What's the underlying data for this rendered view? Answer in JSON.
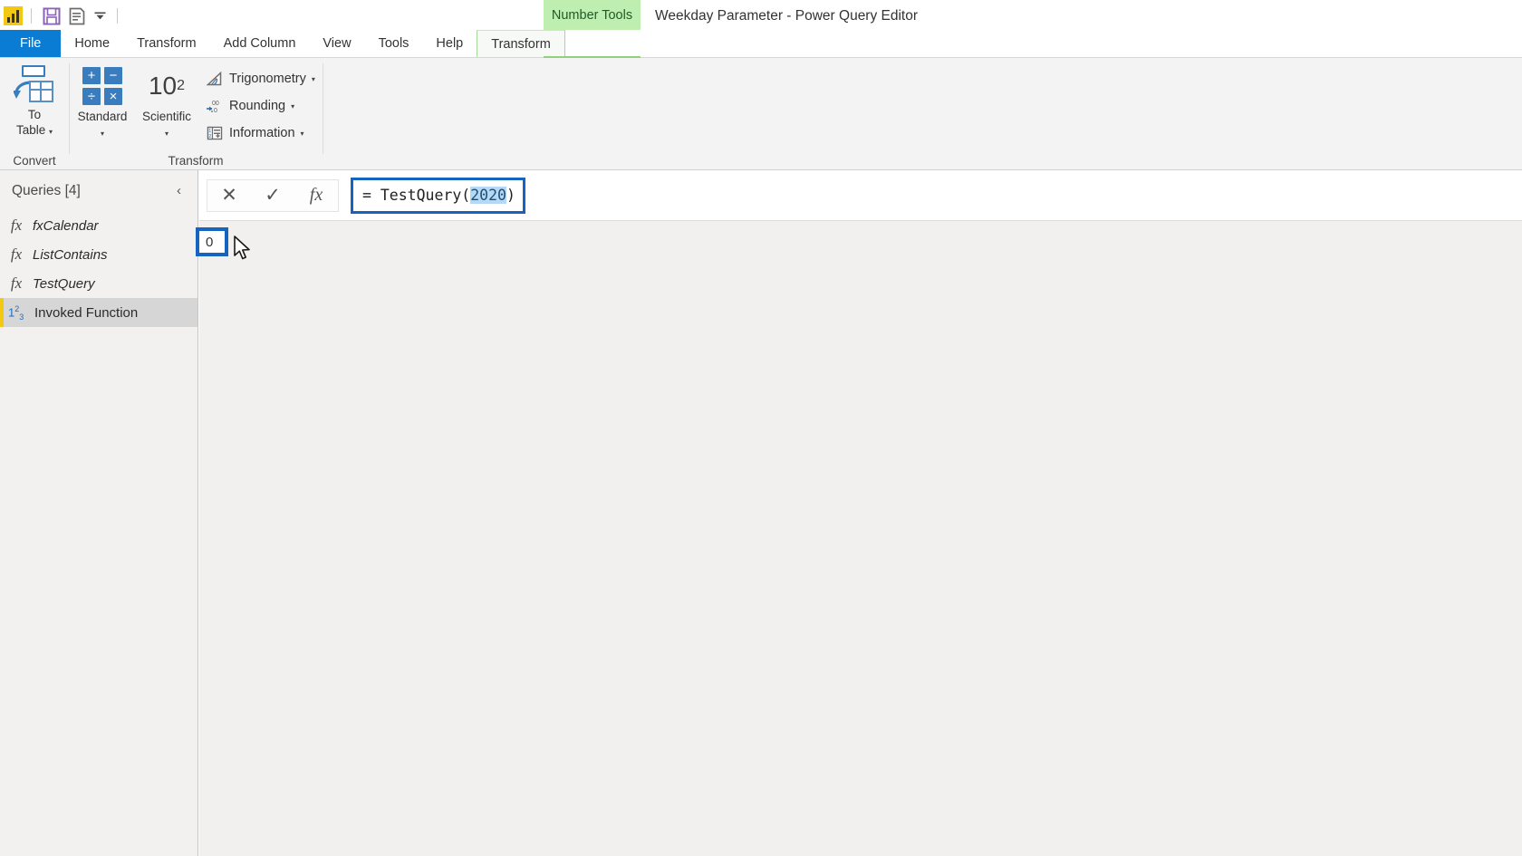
{
  "window": {
    "title": "Weekday Parameter - Power Query Editor",
    "contextual_tab_group": "Number Tools"
  },
  "quick_access": {
    "items": [
      {
        "name": "powerbi-logo",
        "label": "Power BI"
      },
      {
        "name": "save-icon",
        "label": "Save"
      },
      {
        "name": "document-icon",
        "label": "Recent Sources"
      },
      {
        "name": "chevron-down-icon",
        "label": "Customize Quick Access Toolbar"
      }
    ]
  },
  "ribbon": {
    "tabs": [
      {
        "label": "File",
        "state": "file"
      },
      {
        "label": "Home",
        "state": "normal"
      },
      {
        "label": "Transform",
        "state": "normal"
      },
      {
        "label": "Add Column",
        "state": "normal"
      },
      {
        "label": "View",
        "state": "normal"
      },
      {
        "label": "Tools",
        "state": "normal"
      },
      {
        "label": "Help",
        "state": "normal"
      },
      {
        "label": "Transform",
        "state": "contextual-active"
      }
    ],
    "groups": [
      {
        "label": "Convert",
        "buttons": [
          {
            "label_line1": "To",
            "label_line2": "Table",
            "icon": "to-table-icon",
            "has_caret": true
          }
        ]
      },
      {
        "label": "Transform",
        "buttons": [
          {
            "label_line1": "Standard",
            "label_line2": "",
            "icon": "standard-calculator-icon",
            "has_caret": true
          },
          {
            "label_line1": "Scientific",
            "label_line2": "",
            "icon": "scientific-icon",
            "has_caret": true
          }
        ],
        "small_buttons": [
          {
            "label": "Trigonometry",
            "icon": "trigonometry-icon",
            "has_caret": true
          },
          {
            "label": "Rounding",
            "icon": "rounding-icon",
            "has_caret": true
          },
          {
            "label": "Information",
            "icon": "information-icon",
            "has_caret": true
          }
        ]
      }
    ],
    "standard_icon_glyphs": [
      "+",
      "−",
      "÷",
      "×"
    ],
    "scientific_icon_base": "10",
    "scientific_icon_exponent": "2"
  },
  "sidebar": {
    "title": "Queries [4]",
    "collapse_icon": "‹",
    "items": [
      {
        "label": "fxCalendar",
        "icon": "fx-icon",
        "selected": false
      },
      {
        "label": "ListContains",
        "icon": "fx-icon",
        "selected": false
      },
      {
        "label": "TestQuery",
        "icon": "fx-icon",
        "selected": false
      },
      {
        "label": "Invoked Function",
        "icon": "number-type-icon",
        "selected": true
      }
    ],
    "number_icon": {
      "base1": "1",
      "sup": "2",
      "sub": "3"
    }
  },
  "formula_bar": {
    "cancel_icon": "✕",
    "accept_icon": "✓",
    "fx_icon": "fx",
    "prefix": "= TestQuery(",
    "selected_value": "2020",
    "suffix": ")",
    "full_text": "= TestQuery(2020)",
    "highlighted": true
  },
  "result": {
    "value": "0",
    "highlighted": true
  },
  "colors": {
    "accent_blue": "#0b7cd4",
    "annotation_blue": "#1565c0",
    "contextual_green": "#bfeeb1",
    "brand_yellow": "#f2c811",
    "selection_blue": "#b5d9f5",
    "selected_row_grey": "#d6d6d6"
  }
}
